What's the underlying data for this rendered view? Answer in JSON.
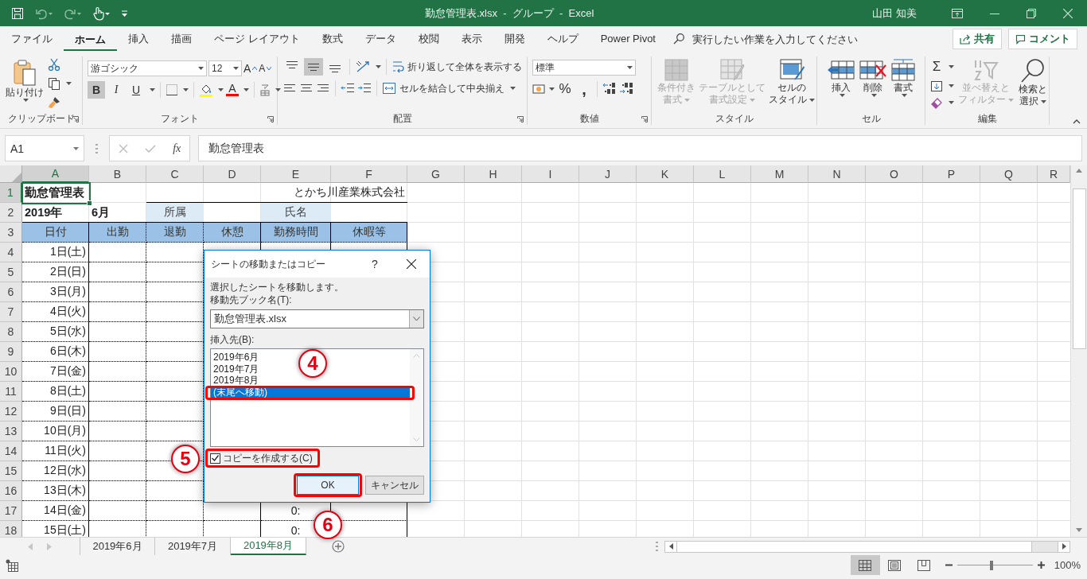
{
  "title_bar": {
    "title": "勤怠管理表.xlsx  -  グループ  -  Excel",
    "user": "山田 知美"
  },
  "menu": {
    "tabs": [
      {
        "label": "ファイル",
        "selected": false
      },
      {
        "label": "ホーム",
        "selected": true
      },
      {
        "label": "挿入",
        "selected": false
      },
      {
        "label": "描画",
        "selected": false
      },
      {
        "label": "ページ レイアウト",
        "selected": false
      },
      {
        "label": "数式",
        "selected": false
      },
      {
        "label": "データ",
        "selected": false
      },
      {
        "label": "校閲",
        "selected": false
      },
      {
        "label": "表示",
        "selected": false
      },
      {
        "label": "開発",
        "selected": false
      },
      {
        "label": "ヘルプ",
        "selected": false
      },
      {
        "label": "Power Pivot",
        "selected": false
      }
    ],
    "search": {
      "placeholder": "実行したい作業を入力してください"
    },
    "share": "共有",
    "comment": "コメント"
  },
  "ribbon": {
    "groups": [
      {
        "kind": "clipboard",
        "label": "クリップボード",
        "launcher": true,
        "paste": "貼り付け"
      },
      {
        "kind": "font",
        "label": "フォント",
        "launcher": true,
        "font_name": "游ゴシック",
        "font_size": "12",
        "grow": "A",
        "shrink": "A",
        "styles": [
          {
            "kind": "bold",
            "label": "B",
            "on": true
          },
          {
            "kind": "italic",
            "label": "I",
            "on": false
          },
          {
            "kind": "underline",
            "label": "U",
            "on": false
          }
        ],
        "font_color": "A"
      },
      {
        "kind": "alignment",
        "label": "配置",
        "launcher": true,
        "vertical": [
          {
            "kind": "top",
            "on": false
          },
          {
            "kind": "middle",
            "on": true
          },
          {
            "kind": "bottom",
            "on": false
          }
        ],
        "wrap": "折り返して全体を表示する",
        "merge": "セルを結合して中央揃え"
      },
      {
        "kind": "number",
        "label": "数値",
        "launcher": true,
        "format": "標準",
        "percent": "%",
        "comma": ","
      },
      {
        "kind": "styles",
        "label": "スタイル",
        "buttons": [
          {
            "kind": "conditional",
            "lines": [
              "条件付き",
              "書式"
            ],
            "disabled": true
          },
          {
            "kind": "table",
            "lines": [
              "テーブルとして",
              "書式設定"
            ],
            "disabled": true
          },
          {
            "kind": "cell_styles",
            "lines": [
              "セルの",
              "スタイル"
            ],
            "disabled": false
          }
        ]
      },
      {
        "kind": "cells",
        "label": "セル",
        "buttons": [
          {
            "kind": "insert",
            "lines": [
              "挿入"
            ],
            "disabled": false
          },
          {
            "kind": "delete",
            "lines": [
              "削除"
            ],
            "disabled": false
          },
          {
            "kind": "format",
            "lines": [
              "書式"
            ],
            "disabled": false
          }
        ]
      },
      {
        "kind": "editing",
        "label": "編集",
        "autosum": "Σ",
        "buttons": [
          {
            "kind": "sort",
            "lines": [
              "並べ替えと",
              "フィルター"
            ],
            "disabled": true
          },
          {
            "kind": "find",
            "lines": [
              "検索と",
              "選択"
            ],
            "disabled": false
          }
        ]
      }
    ]
  },
  "formula_bar": {
    "name_box": "A1",
    "function_label": "fx",
    "formula": "勤怠管理表"
  },
  "sheet": {
    "columns": [
      {
        "label": "A",
        "selected": true
      },
      {
        "label": "B",
        "selected": false
      },
      {
        "label": "C",
        "selected": false
      },
      {
        "label": "D",
        "selected": false
      },
      {
        "label": "E",
        "selected": false
      },
      {
        "label": "F",
        "selected": false
      },
      {
        "label": "G",
        "selected": false
      },
      {
        "label": "H",
        "selected": false
      },
      {
        "label": "I",
        "selected": false
      },
      {
        "label": "J",
        "selected": false
      },
      {
        "label": "K",
        "selected": false
      },
      {
        "label": "L",
        "selected": false
      },
      {
        "label": "M",
        "selected": false
      },
      {
        "label": "N",
        "selected": false
      },
      {
        "label": "O",
        "selected": false
      },
      {
        "label": "P",
        "selected": false
      },
      {
        "label": "Q",
        "selected": false
      },
      {
        "label": "R",
        "selected": false
      }
    ],
    "rows": [
      {
        "number": "1",
        "selected": true,
        "kind": "title",
        "cells": {
          "A": {
            "text": "勤怠管理表"
          },
          "E": {
            "text": "とかち川産業株式会社",
            "kind": "merged"
          }
        }
      },
      {
        "number": "2",
        "selected": false,
        "kind": "info",
        "cells": {
          "A": {
            "text": "2019年"
          },
          "B": {
            "text": "6月"
          },
          "C": {
            "text": "所属",
            "kind": "label"
          },
          "E": {
            "text": "氏名",
            "kind": "label"
          }
        }
      },
      {
        "number": "3",
        "selected": false,
        "kind": "header",
        "cells": {
          "A": {
            "text": "日付"
          },
          "B": {
            "text": "出勤"
          },
          "C": {
            "text": "退勤"
          },
          "D": {
            "text": "休憩"
          },
          "E": {
            "text": "勤務時間"
          },
          "F": {
            "text": "休暇等"
          }
        }
      },
      {
        "number": "4",
        "selected": false,
        "kind": "day",
        "cells": {
          "A": {
            "text": "1日(土)"
          }
        }
      },
      {
        "number": "5",
        "selected": false,
        "kind": "day",
        "cells": {
          "A": {
            "text": "2日(日)"
          }
        }
      },
      {
        "number": "6",
        "selected": false,
        "kind": "day",
        "cells": {
          "A": {
            "text": "3日(月)"
          }
        }
      },
      {
        "number": "7",
        "selected": false,
        "kind": "day",
        "cells": {
          "A": {
            "text": "4日(火)"
          }
        }
      },
      {
        "number": "8",
        "selected": false,
        "kind": "day",
        "cells": {
          "A": {
            "text": "5日(水)"
          }
        }
      },
      {
        "number": "9",
        "selected": false,
        "kind": "day",
        "cells": {
          "A": {
            "text": "6日(木)"
          }
        }
      },
      {
        "number": "10",
        "selected": false,
        "kind": "day",
        "cells": {
          "A": {
            "text": "7日(金)"
          }
        }
      },
      {
        "number": "11",
        "selected": false,
        "kind": "day",
        "cells": {
          "A": {
            "text": "8日(土)"
          }
        }
      },
      {
        "number": "12",
        "selected": false,
        "kind": "day",
        "cells": {
          "A": {
            "text": "9日(日)"
          }
        }
      },
      {
        "number": "13",
        "selected": false,
        "kind": "day",
        "cells": {
          "A": {
            "text": "10日(月)"
          }
        }
      },
      {
        "number": "14",
        "selected": false,
        "kind": "day",
        "cells": {
          "A": {
            "text": "11日(火)"
          }
        }
      },
      {
        "number": "15",
        "selected": false,
        "kind": "day",
        "cells": {
          "A": {
            "text": "12日(水)"
          }
        }
      },
      {
        "number": "16",
        "selected": false,
        "kind": "day",
        "cells": {
          "A": {
            "text": "13日(木)"
          }
        }
      },
      {
        "number": "17",
        "selected": false,
        "kind": "day",
        "cells": {
          "A": {
            "text": "14日(金)"
          },
          "E": {
            "text": "0:"
          }
        }
      },
      {
        "number": "18",
        "selected": false,
        "kind": "day",
        "cells": {
          "A": {
            "text": "15日(土)"
          },
          "E": {
            "text": "0:"
          }
        }
      }
    ]
  },
  "dialog": {
    "title": "シートの移動またはコピー",
    "help": "?",
    "message": "選択したシートを移動します。",
    "book_label": "移動先ブック名(T):",
    "book": "勤怠管理表.xlsx",
    "before_label": "挿入先(B):",
    "sheets": [
      {
        "label": "2019年6月",
        "selected": false
      },
      {
        "label": "2019年7月",
        "selected": false
      },
      {
        "label": "2019年8月",
        "selected": false
      },
      {
        "label": "(末尾へ移動)",
        "selected": true
      }
    ],
    "copy": {
      "label": "コピーを作成する(C)",
      "checked": true
    },
    "buttons": [
      {
        "label": "OK",
        "kind": "default"
      },
      {
        "label": "キャンセル",
        "kind": "normal"
      }
    ]
  },
  "annotations": [
    {
      "label": "4"
    },
    {
      "label": "5"
    },
    {
      "label": "6"
    }
  ],
  "sheet_tabs": [
    {
      "label": "2019年6月",
      "selected": false
    },
    {
      "label": "2019年7月",
      "selected": false
    },
    {
      "label": "2019年8月",
      "selected": true
    }
  ],
  "status_bar": {
    "views": [
      {
        "kind": "normal",
        "selected": true
      },
      {
        "kind": "page_layout",
        "selected": false
      },
      {
        "kind": "page_break",
        "selected": false
      }
    ],
    "zoom": {
      "level": 0.46,
      "reading": "100%"
    }
  }
}
